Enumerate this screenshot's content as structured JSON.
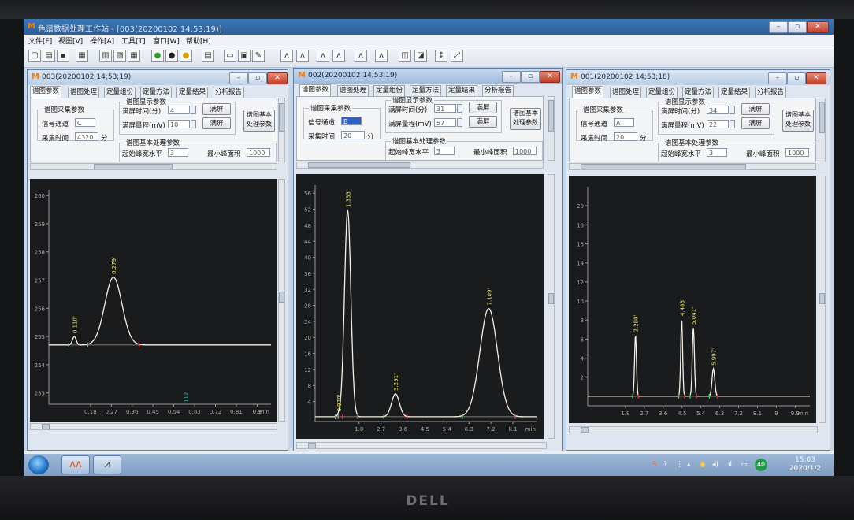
{
  "main_window": {
    "title": "色谱数据处理工作站 - [003(20200102 14:53:19)]",
    "menu": [
      "文件[F]",
      "视图[V]",
      "操作[A]",
      "工具[T]",
      "窗口[W]",
      "帮助[H]"
    ]
  },
  "tabs": [
    "谱图参数",
    "谱图处理",
    "定量组份",
    "定量方法",
    "定量结果",
    "分析报告"
  ],
  "labels": {
    "acq_group": "谱图采集参数",
    "display_group": "谱图显示参数",
    "basic_group": "谱图基本处理参数",
    "channel": "信号通道",
    "acq_time": "采集时间",
    "minutes_unit": "分",
    "full_time": "满屏时间(分)",
    "full_range": "满屏量程(mV)",
    "fullscreen_btn": "满屏",
    "baseline": "起始峰宽水平",
    "min_area": "最小峰面积",
    "side_btn": "谱图基本处理参数"
  },
  "windows": [
    {
      "id": "w003",
      "title": "003(20200102 14;53;19)",
      "channel": "C",
      "acq_time": "4320",
      "full_time": "4",
      "full_range": "10",
      "baseline": "3",
      "min_area": "1000",
      "chart_data": {
        "type": "line",
        "xlabel": "min",
        "xlim": [
          0,
          0.96
        ],
        "ylim": [
          252.6,
          260.2
        ],
        "x_ticks": [
          "0.18",
          "0.27",
          "0.36",
          "0.45",
          "0.54",
          "0.63",
          "0.72",
          "0.81",
          "0.9"
        ],
        "y_ticks": [
          "253",
          "254",
          "255",
          "256",
          "257",
          "258",
          "259",
          "260"
        ],
        "baseline_y": 254.7,
        "peaks": [
          {
            "label": "0.110'",
            "x": 0.11,
            "height": 0.3,
            "width": 0.008
          },
          {
            "label": "0.279'",
            "x": 0.279,
            "height": 2.4,
            "width": 0.037
          }
        ],
        "cursor_label": "112"
      }
    },
    {
      "id": "w002",
      "title": "002(20200102 14;53;19)",
      "channel": "B",
      "acq_time": "20",
      "full_time": "31",
      "full_range": "57",
      "baseline": "3",
      "min_area": "1000",
      "chart_data": {
        "type": "line",
        "xlabel": "min",
        "xlim": [
          0,
          9.1
        ],
        "ylim": [
          -1,
          58
        ],
        "x_ticks": [
          "1.8",
          "2.7",
          "3.6",
          "4.5",
          "5.4",
          "6.3",
          "7.2",
          "8.1"
        ],
        "y_ticks": [
          "4",
          "8",
          "12",
          "16",
          "20",
          "24",
          "28",
          "32",
          "36",
          "40",
          "44",
          "48",
          "52",
          "56"
        ],
        "baseline_y": 0.2,
        "peaks": [
          {
            "label": "0.970'",
            "x": 0.97,
            "height": 0.5,
            "width": 0.05
          },
          {
            "label": "1.333'",
            "x": 1.333,
            "height": 51.5,
            "width": 0.13
          },
          {
            "label": "3.291'",
            "x": 3.291,
            "height": 5.7,
            "width": 0.16
          },
          {
            "label": "7.109'",
            "x": 7.109,
            "height": 27,
            "width": 0.36
          }
        ]
      }
    },
    {
      "id": "w001",
      "title": "001(20200102 14;53;18)",
      "channel": "A",
      "acq_time": "20",
      "full_time": "34",
      "full_range": "22",
      "baseline": "3",
      "min_area": "1000",
      "chart_data": {
        "type": "line",
        "xlabel": "min",
        "xlim": [
          0,
          10.6
        ],
        "ylim": [
          -1,
          22
        ],
        "x_ticks": [
          "1.8",
          "2.7",
          "3.6",
          "4.5",
          "5.4",
          "6.3",
          "7.2",
          "8.1",
          "9",
          "9.9"
        ],
        "y_ticks": [
          "2",
          "4",
          "6",
          "8",
          "10",
          "12",
          "14",
          "16",
          "18",
          "20"
        ],
        "baseline_y": 0,
        "peaks": [
          {
            "label": "2.280'",
            "x": 2.28,
            "height": 6.4,
            "width": 0.045
          },
          {
            "label": "4.483'",
            "x": 4.483,
            "height": 8.1,
            "width": 0.045
          },
          {
            "label": "5.041'",
            "x": 5.041,
            "height": 7.2,
            "width": 0.05
          },
          {
            "label": "5.997'",
            "x": 5.997,
            "height": 2.9,
            "width": 0.065
          }
        ]
      }
    }
  ],
  "taskbar": {
    "time": "15:03",
    "date": "2020/1/2",
    "tray_badge": "40"
  },
  "brand": "DELL",
  "colors": {
    "chart_bg": "#1a1b1d",
    "trace": "#f4efe4",
    "peak_label": "#e8e46a",
    "marker_green": "#5bd35b",
    "marker_red": "#e04040"
  }
}
